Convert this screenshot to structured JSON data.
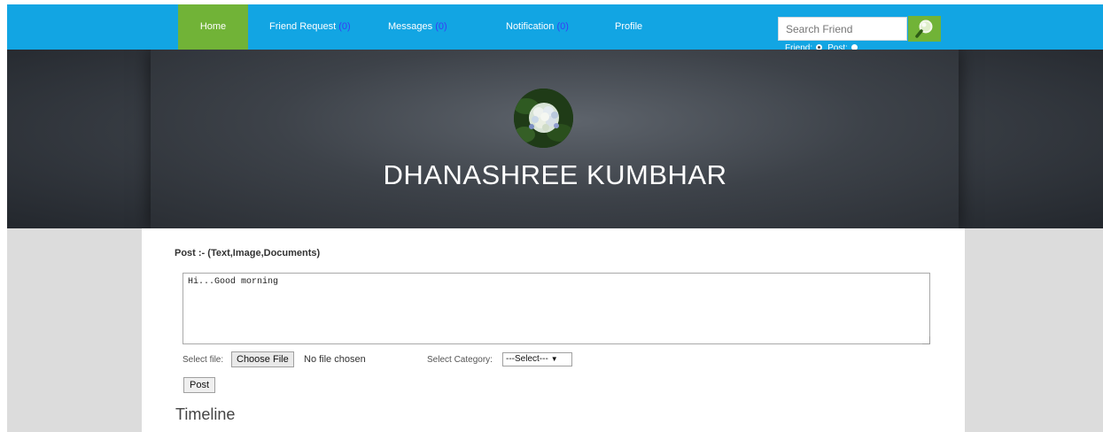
{
  "nav": {
    "home": "Home",
    "friend_request": {
      "label": "Friend Request ",
      "count": "(0)"
    },
    "messages": {
      "label": "Messages ",
      "count": "(0)"
    },
    "notification": {
      "label": "Notification ",
      "count": "(0)"
    },
    "profile": "Profile"
  },
  "search": {
    "placeholder": "Search Friend",
    "button_icon": "search-icon",
    "mode_friend_label": "Friend:",
    "mode_post_label": "Post:",
    "mode_selected": "friend"
  },
  "profile": {
    "name": "DHANASHREE KUMBHAR",
    "avatar_icon": "hydrangea-flower-photo"
  },
  "post_form": {
    "heading": "Post :- (Text,Image,Documents)",
    "text_value": "Hi...Good morning",
    "file_label": "Select file:",
    "choose_file_label": "Choose File",
    "no_file_text": "No file chosen",
    "category_label": "Select Category:",
    "category_selected": "---Select---",
    "post_button": "Post"
  },
  "timeline": {
    "heading": "Timeline"
  },
  "colors": {
    "topbar": "#12a5e3",
    "home_active": "#71b337",
    "count": "#3a3df5",
    "page_bg": "#dcdcdc"
  }
}
